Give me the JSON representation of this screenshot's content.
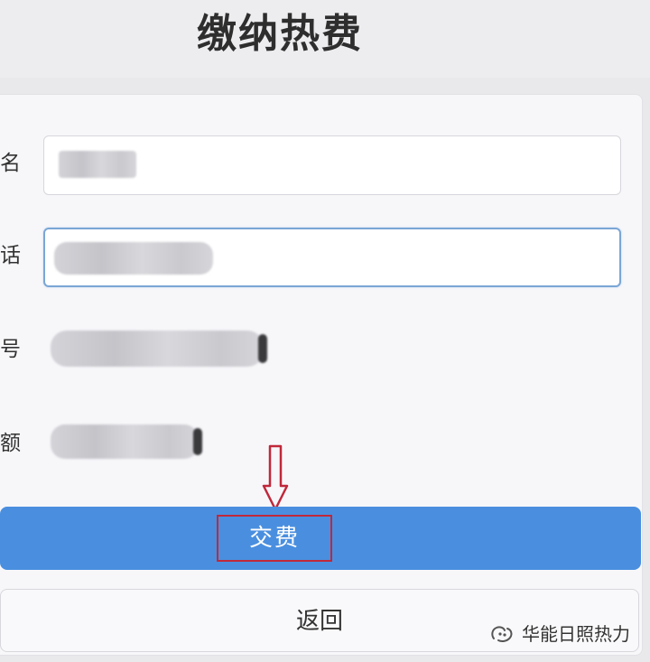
{
  "header": {
    "title": "缴纳热费"
  },
  "form": {
    "fields": [
      {
        "label": "名"
      },
      {
        "label": "话"
      },
      {
        "label": "号"
      },
      {
        "label": "额"
      }
    ]
  },
  "buttons": {
    "pay_label": "交费",
    "back_label": "返回"
  },
  "watermark": {
    "text": "华能日照热力",
    "icon": "wechat-official-account-icon"
  },
  "colors": {
    "primary": "#4a8fdf",
    "highlight_box": "#c0283a",
    "arrow": "#c0283a"
  }
}
